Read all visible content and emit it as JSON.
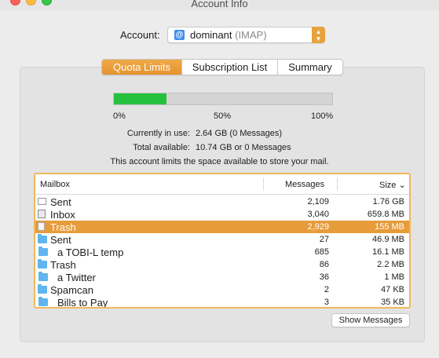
{
  "window": {
    "title": "Account Info"
  },
  "account": {
    "label": "Account:",
    "name": "dominant",
    "type": "(IMAP)",
    "icon": "at-sign-icon"
  },
  "tabs": [
    {
      "label": "Quota Limits",
      "active": true
    },
    {
      "label": "Subscription List",
      "active": false
    },
    {
      "label": "Summary",
      "active": false
    }
  ],
  "quota": {
    "fraction": 0.24,
    "fill_color": "#25c13e",
    "ticks": [
      "0%",
      "50%",
      "100%"
    ],
    "in_use_label": "Currently in use:",
    "in_use_value": "2.64 GB (0 Messages)",
    "available_label": "Total available:",
    "available_value": "10.74 GB or 0 Messages",
    "note": "This account limits the space available to store your mail."
  },
  "table": {
    "columns": {
      "mailbox": "Mailbox",
      "messages": "Messages",
      "size": "Size",
      "sort_indicator": "⌄"
    },
    "rows": [
      {
        "name": "Sent",
        "icon": "sent-icon",
        "indent": 0,
        "messages": "2,109",
        "size": "1.76 GB",
        "selected": false
      },
      {
        "name": "Inbox",
        "icon": "inbox-icon",
        "indent": 0,
        "messages": "3,040",
        "size": "659.8 MB",
        "selected": false
      },
      {
        "name": "Trash",
        "icon": "trash-icon",
        "indent": 0,
        "messages": "2,929",
        "size": "155 MB",
        "selected": true
      },
      {
        "name": "Sent",
        "icon": "folder-icon",
        "indent": 0,
        "messages": "27",
        "size": "46.9 MB",
        "selected": false
      },
      {
        "name": "a TOBI-L temp",
        "icon": "folder-icon",
        "indent": 1,
        "messages": "685",
        "size": "16.1 MB",
        "selected": false
      },
      {
        "name": "Trash",
        "icon": "folder-icon",
        "indent": 0,
        "messages": "86",
        "size": "2.2 MB",
        "selected": false
      },
      {
        "name": "a Twitter",
        "icon": "folder-icon",
        "indent": 1,
        "messages": "36",
        "size": "1 MB",
        "selected": false
      },
      {
        "name": "Spamcan",
        "icon": "folder-icon",
        "indent": 0,
        "messages": "2",
        "size": "47 KB",
        "selected": false
      },
      {
        "name": "Bills to Pay",
        "icon": "folder-icon",
        "indent": 1,
        "messages": "3",
        "size": "35 KB",
        "selected": false
      }
    ]
  },
  "buttons": {
    "show_messages": "Show Messages"
  },
  "colors": {
    "accent": "#e69c3a",
    "selection": "#e69c3a"
  }
}
